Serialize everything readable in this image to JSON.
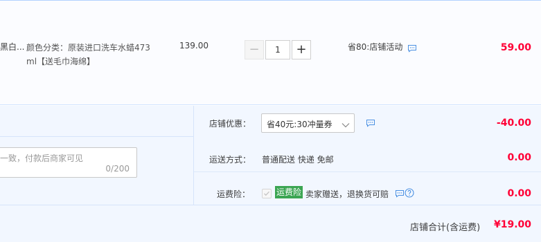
{
  "item": {
    "product_name_fragment": "黑白...",
    "sku_line1": "颜色分类：原装进口洗车水蜡473",
    "sku_line2": "ml【送毛巾海绵】",
    "price": "139.00",
    "quantity": "1",
    "minus_symbol": "−",
    "plus_symbol": "+",
    "promo": "省80:店铺活动",
    "subtotal": "59.00"
  },
  "message": {
    "placeholder": "一致，付款后商家可见",
    "counter": "0/200"
  },
  "discount": {
    "label": "店铺优惠：",
    "coupon_selected": "省40元:30冲量券",
    "amount": "-40.00"
  },
  "shipping": {
    "label": "运送方式：",
    "value": "普通配送 快递 免邮",
    "amount": "0.00"
  },
  "insurance": {
    "label": "运费险：",
    "badge": "运费险",
    "description": "卖家赠送，退换货可赔",
    "amount": "0.00"
  },
  "store_total": {
    "label": "店铺合计(含运费)",
    "value": "¥19.00"
  },
  "colors": {
    "accent_red": "#ff0036",
    "badge_green": "#3ba552",
    "border_blue": "#b2d1ff",
    "panel_bg": "#f2f7ff"
  },
  "icons": [
    "chat-bubble-icon",
    "chevron-down-icon",
    "checkmark-icon",
    "help-circle-icon"
  ]
}
